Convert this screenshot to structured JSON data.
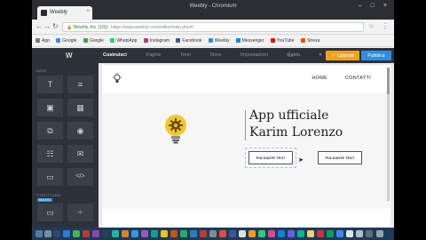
{
  "browser": {
    "tab_title": "Weebly",
    "window_title": "Weebly - Chromium",
    "window_controls": "– □ ×",
    "url_secure": "Weebly, Inc. [US]",
    "url_path": "https://www.weebly.com/editor/main.php#/",
    "bookmarks": [
      {
        "label": "App",
        "color": "#7a7a7a"
      },
      {
        "label": "Google",
        "color": "#4285f4"
      },
      {
        "label": "Google",
        "color": "#34a853"
      },
      {
        "label": "WhatsApp",
        "color": "#25d366"
      },
      {
        "label": "Instagram",
        "color": "#c13584"
      },
      {
        "label": "Facebook",
        "color": "#3b5998"
      },
      {
        "label": "Weebly",
        "color": "#2e8ee0"
      },
      {
        "label": "Messenger",
        "color": "#0084ff"
      },
      {
        "label": "YouTube",
        "color": "#ff0000"
      },
      {
        "label": "Streva",
        "color": "#fc4c02"
      }
    ]
  },
  "weebly": {
    "logo": "W",
    "tabs": [
      "Costruisci",
      "Pagine",
      "Temi",
      "Store",
      "Impostazioni",
      "Guida"
    ],
    "active_tab": "Costruisci",
    "upgrade_label": "⚡ Upgrade",
    "publish_label": "Pubblica",
    "colors": {
      "upgrade": "#f0a21b",
      "publish": "#2e8ee0",
      "sidebar": "#2d3139"
    }
  },
  "sidebar": {
    "basic_label": "BASE",
    "structure_label": "STRUTTURA",
    "new_badge": "NUOVO",
    "basic_items": [
      {
        "icon": "title-icon",
        "glyph": "T"
      },
      {
        "icon": "text-icon",
        "glyph": "≡"
      },
      {
        "icon": "image-icon",
        "glyph": "▣"
      },
      {
        "icon": "gallery-icon",
        "glyph": "▦"
      },
      {
        "icon": "slideshow-icon",
        "glyph": "⧉"
      },
      {
        "icon": "map-icon",
        "glyph": "◉"
      },
      {
        "icon": "contact-form-icon",
        "glyph": "☷"
      },
      {
        "icon": "email-icon",
        "glyph": "✉"
      },
      {
        "icon": "button-icon",
        "glyph": "▭"
      },
      {
        "icon": "embed-code-icon",
        "glyph": "</>"
      }
    ],
    "structure_items": [
      {
        "icon": "section-icon",
        "glyph": "▭"
      },
      {
        "icon": "divider-icon",
        "glyph": "÷"
      }
    ]
  },
  "site": {
    "nav": [
      "HOME",
      "CONTATTI"
    ],
    "title_line1": "App ufficiale",
    "title_line2": "Karim Lorenzo",
    "button1": "PULSANTE TEXT",
    "button2": "PULSANTE TEXT"
  }
}
